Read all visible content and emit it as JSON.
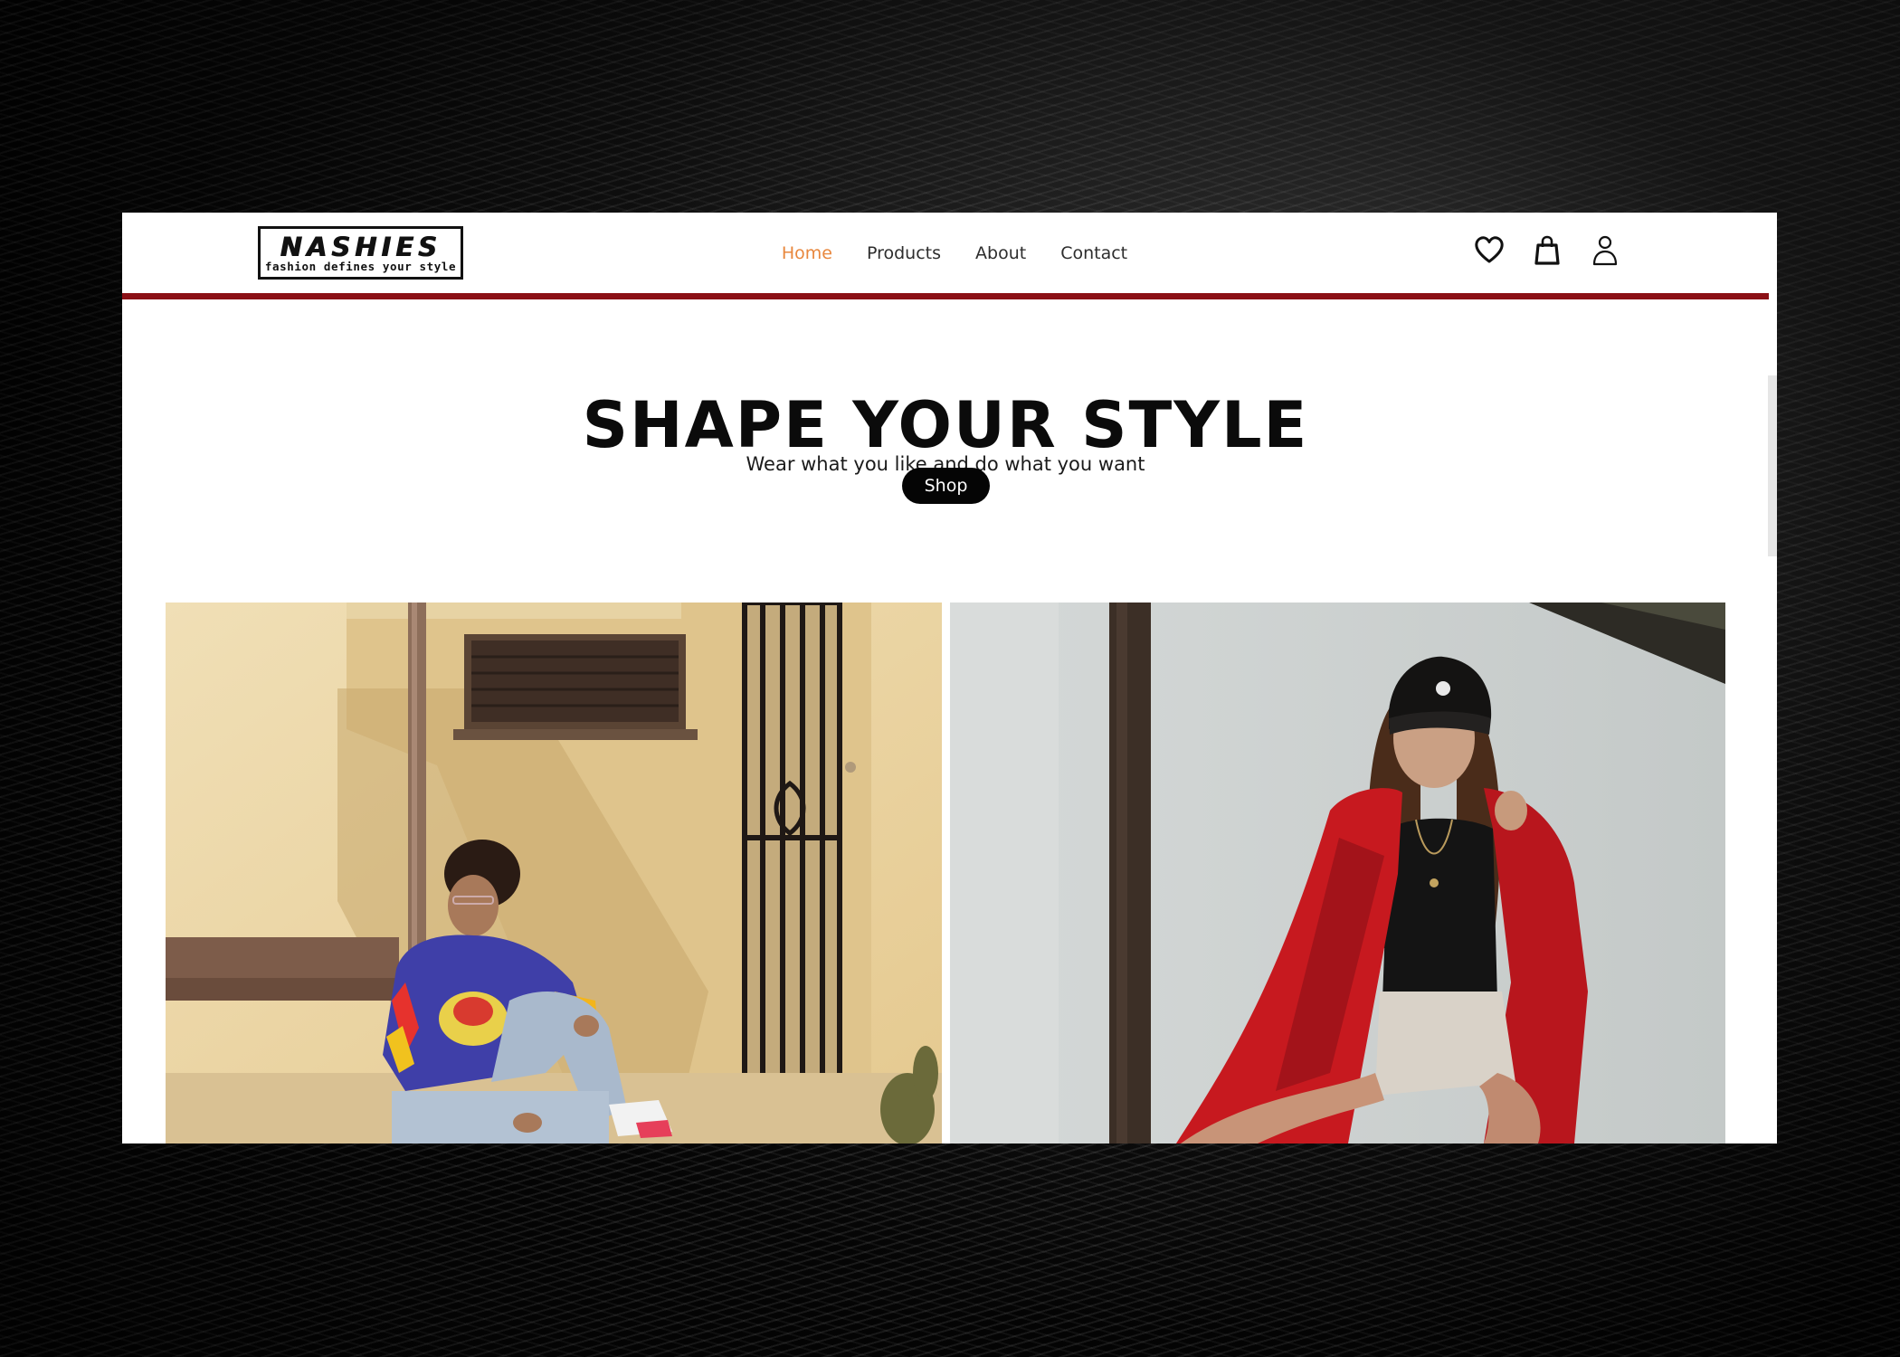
{
  "brand": {
    "logo_word": "NASHIES",
    "logo_tagline": "fashion defines your style"
  },
  "nav": {
    "links": [
      {
        "label": "Home",
        "active": true
      },
      {
        "label": "Products",
        "active": false
      },
      {
        "label": "About",
        "active": false
      },
      {
        "label": "Contact",
        "active": false
      }
    ],
    "icons": [
      "heart-icon",
      "shopping-bag-icon",
      "user-icon"
    ],
    "active_color": "#e8873d",
    "rule_color": "#8b1016"
  },
  "hero": {
    "title": "SHAPE YOUR STYLE",
    "subtitle": "Wear what you like and do what you want",
    "cta_label": "Shop"
  },
  "gallery": {
    "images": [
      "man-in-hockey-jersey-photo",
      "woman-in-red-jacket-photo"
    ]
  }
}
